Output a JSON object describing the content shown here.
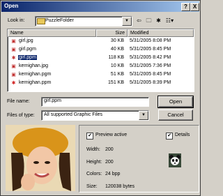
{
  "title": "Open",
  "title_buttons": {
    "help": "?",
    "close": "X"
  },
  "look_in": {
    "label": "Look in:",
    "value": "PuzzleFolder"
  },
  "columns": {
    "name": "Name",
    "size": "Size",
    "modified": "Modified"
  },
  "files": [
    {
      "name": "girl.jpg",
      "size": "30 KB",
      "modified": "5/31/2005 8:08 PM"
    },
    {
      "name": "girl.pgm",
      "size": "40 KB",
      "modified": "5/31/2005 8:45 PM"
    },
    {
      "name": "girl.ppm",
      "size": "118 KB",
      "modified": "5/31/2005 8:42 PM"
    },
    {
      "name": "kernighan.jpg",
      "size": "10 KB",
      "modified": "5/31/2005 7:36 PM"
    },
    {
      "name": "kernighan.pgm",
      "size": "51 KB",
      "modified": "5/31/2005 8:45 PM"
    },
    {
      "name": "kernighan.ppm",
      "size": "151 KB",
      "modified": "5/31/2005 8:39 PM"
    }
  ],
  "file_name": {
    "label": "File name:",
    "value": "girl.ppm"
  },
  "file_type": {
    "label": "Files of type:",
    "value": "All supported Graphic Files"
  },
  "buttons": {
    "open": "Open",
    "cancel": "Cancel"
  },
  "preview": {
    "preview_active": "Preview active",
    "details": "Details",
    "width_label": "Width:",
    "width": "200",
    "height_label": "Height:",
    "height": "200",
    "colors_label": "Colors:",
    "colors": "24 bpp",
    "size_label": "Size:",
    "size": "120038 bytes"
  }
}
